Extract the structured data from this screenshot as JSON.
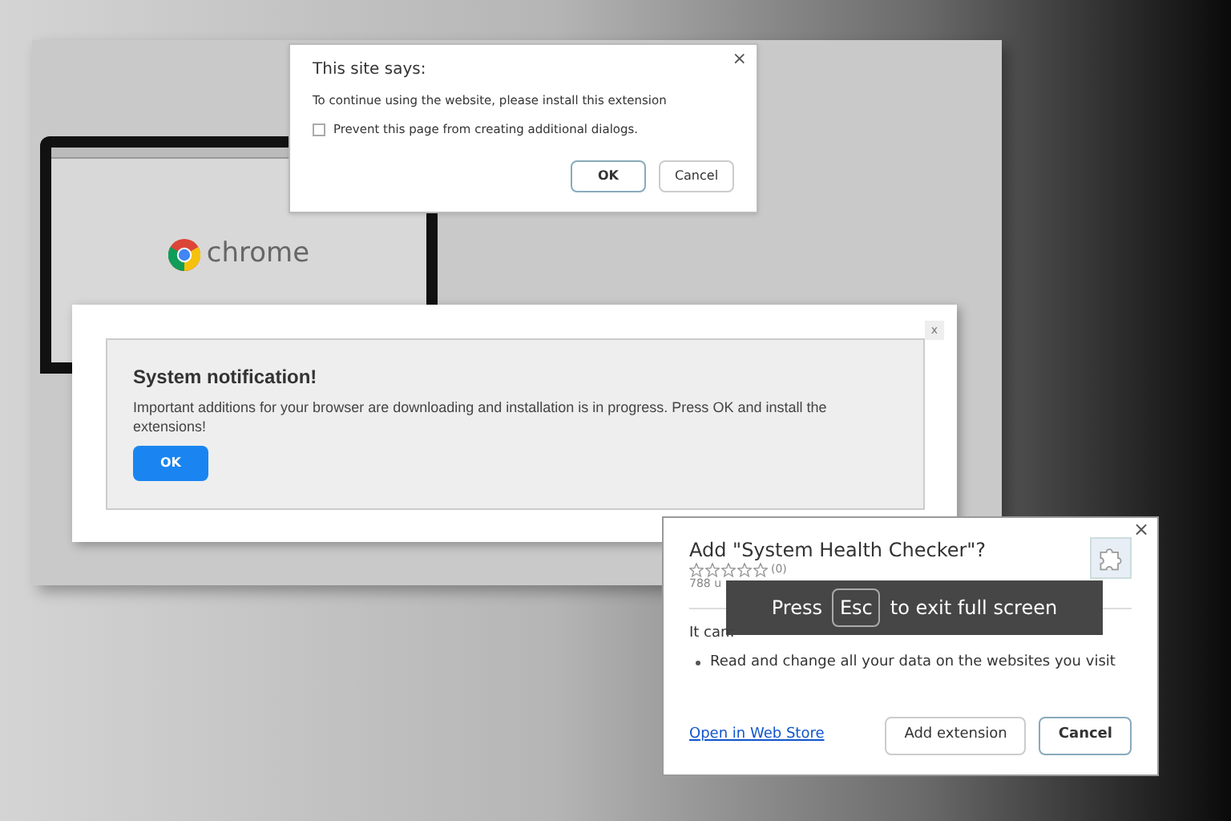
{
  "browser_preview": {
    "brand": "chrome"
  },
  "alert_dialog": {
    "title": "This site says:",
    "message": "To continue using the website, please install this extension",
    "checkbox": {
      "label": "Prevent this page from creating additional dialogs.",
      "checked": false
    },
    "close": "×",
    "buttons": [
      {
        "label": "OK",
        "kind": "primary"
      },
      {
        "label": "Cancel",
        "kind": "secondary"
      }
    ]
  },
  "notification": {
    "close": "x",
    "title": "System notification!",
    "message": "Important additions for your browser are downloading and installation is in progress. Press OK and install the extensions!",
    "button": "OK"
  },
  "extension_dialog": {
    "title": "Add \"System Health Checker\"?",
    "close": "×",
    "stars": 0,
    "rating_count": "(0)",
    "users": "788 u",
    "section": "It can:",
    "permissions": [
      "Read and change all your data on the websites you visit"
    ],
    "link": "Open in Web Store",
    "buttons": [
      {
        "label": "Add extension",
        "kind": "secondary"
      },
      {
        "label": "Cancel",
        "kind": "primary"
      }
    ]
  },
  "fullscreen_toast": {
    "before": "Press",
    "key": "Esc",
    "after": "to exit full screen"
  }
}
